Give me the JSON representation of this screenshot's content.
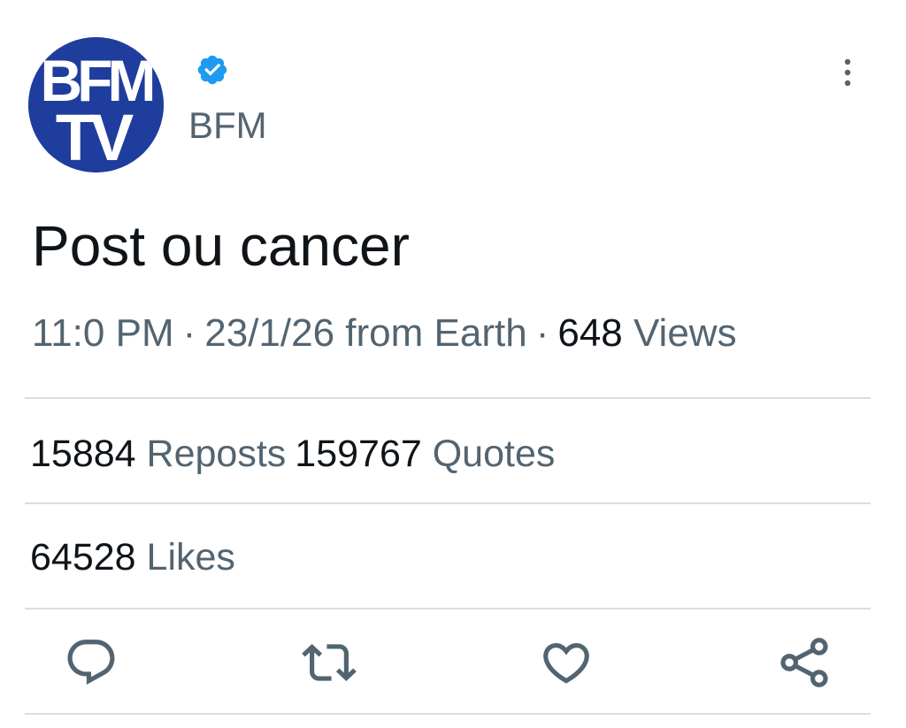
{
  "account": {
    "logo_line1": "BFM",
    "logo_line2": "TV",
    "handle": "BFM",
    "verified_icon": "verified-badge-icon",
    "brand_color": "#1f3d9c",
    "verified_color": "#1d9bf0"
  },
  "post": {
    "text": "Post ou cancer"
  },
  "meta": {
    "time": "11:0 PM",
    "separator": "·",
    "date_location": "23/1/26 from Earth",
    "views_count": "648",
    "views_label": "Views"
  },
  "stats": {
    "reposts_count": "15884",
    "reposts_label": "Reposts",
    "quotes_count": "159767",
    "quotes_label": "Quotes",
    "likes_count": "64528",
    "likes_label": "Likes"
  },
  "actions": [
    {
      "icon": "reply-icon"
    },
    {
      "icon": "repost-icon"
    },
    {
      "icon": "like-icon"
    },
    {
      "icon": "share-icon"
    }
  ],
  "colors": {
    "secondary_text": "#536471",
    "primary_text": "#0f1419",
    "divider": "#d9dde0"
  }
}
